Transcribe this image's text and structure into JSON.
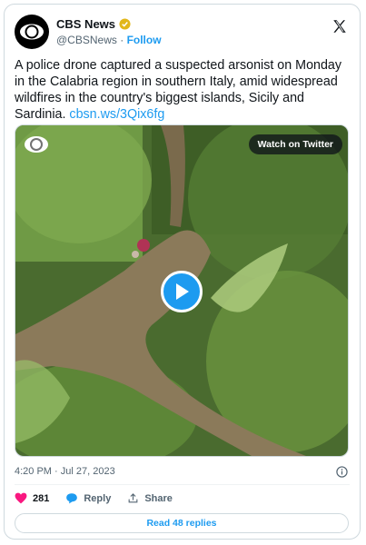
{
  "author": {
    "display_name": "CBS News",
    "handle": "@CBSNews",
    "follow_label": "Follow",
    "separator": "·"
  },
  "tweet": {
    "text": "A police drone captured a suspected arsonist on Monday in the Calabria region in southern Italy, amid widespread wildfires in the country's biggest islands, Sicily and Sardinia.",
    "link": "cbsn.ws/3Qix6fg"
  },
  "media": {
    "watch_label": "Watch on Twitter"
  },
  "meta": {
    "time": "4:20 PM",
    "separator": "·",
    "date": "Jul 27, 2023"
  },
  "actions": {
    "like_count": "281",
    "reply_label": "Reply",
    "share_label": "Share"
  },
  "read_replies_label": "Read 48 replies",
  "colors": {
    "accent": "#1d9bf0",
    "like": "#f91880",
    "verified": "#e2b719"
  }
}
